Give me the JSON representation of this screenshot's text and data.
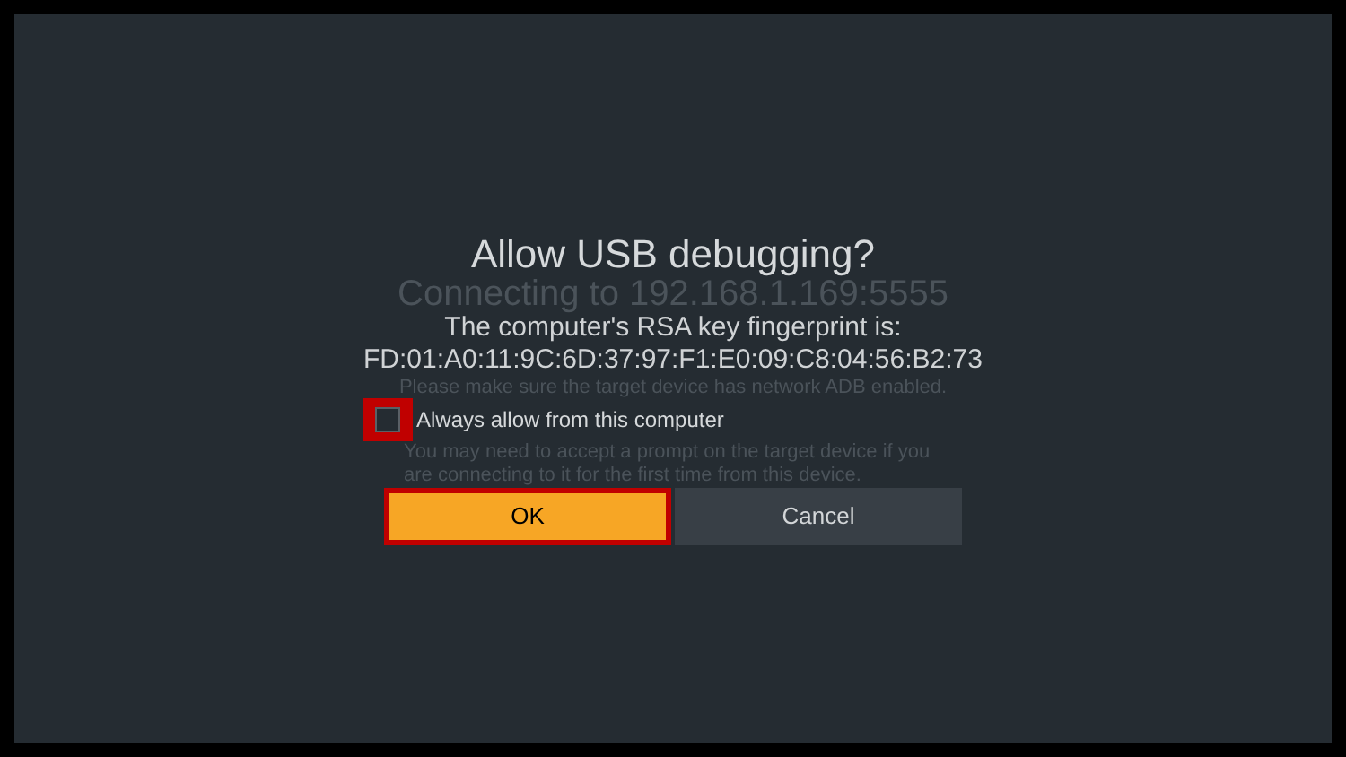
{
  "background": {
    "status": "Connecting to 192.168.1.169:5555",
    "hint": "Please make sure the target device has network ADB enabled.",
    "note": "You may need to accept a prompt on the target device if you are connecting to it for the first time from this device."
  },
  "dialog": {
    "title": "Allow USB debugging?",
    "message": "The computer's RSA key fingerprint is:",
    "fingerprint": "FD:01:A0:11:9C:6D:37:97:F1:E0:09:C8:04:56:B2:73",
    "checkbox": {
      "label": "Always allow from this computer",
      "checked": false,
      "highlighted": true
    },
    "buttons": [
      {
        "label": "OK",
        "kind": "primary",
        "highlighted": true
      },
      {
        "label": "Cancel",
        "kind": "secondary",
        "highlighted": false
      }
    ]
  }
}
